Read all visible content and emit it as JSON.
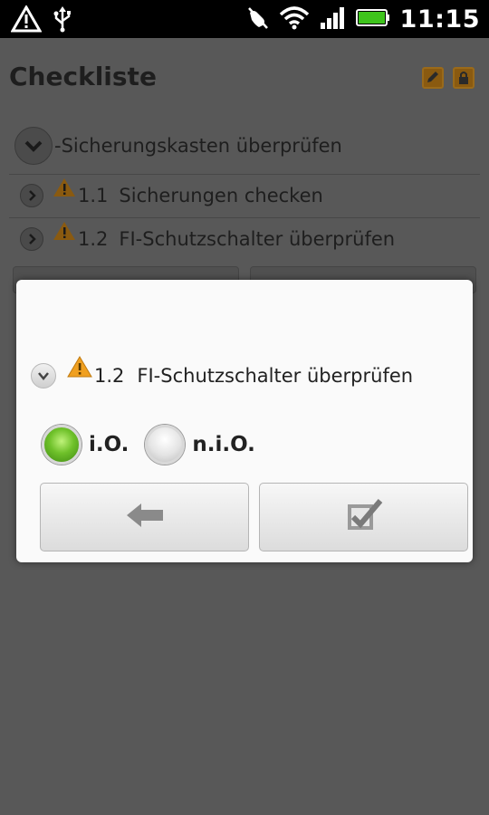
{
  "status_bar": {
    "time": "11:15",
    "icons": [
      "warning-icon",
      "usb-icon",
      "signal-muted-icon",
      "wifi-icon",
      "cell-signal-icon",
      "battery-icon"
    ]
  },
  "app": {
    "title": "Checkliste",
    "title_icons": [
      "edit-icon",
      "lock-icon"
    ],
    "section": {
      "label": "-Sicherungskasten überprüfen",
      "icon": "chevron-down-icon"
    },
    "items": [
      {
        "number": "1.1",
        "label": "Sicherungen checken",
        "icon": "warning-icon"
      },
      {
        "number": "1.2",
        "label": "FI-Schutzschalter überprüfen",
        "icon": "warning-icon"
      }
    ]
  },
  "dialog": {
    "item_number": "1.2",
    "item_label": "FI-Schutzschalter überprüfen",
    "options": [
      {
        "label": "i.O.",
        "checked": true
      },
      {
        "label": "n.i.O.",
        "checked": false
      }
    ],
    "buttons": [
      "back-arrow-icon",
      "confirm-check-icon"
    ]
  },
  "colors": {
    "accent_orange": "#f0a020",
    "radio_green": "#6fc12a",
    "dim_background": "#585858"
  }
}
